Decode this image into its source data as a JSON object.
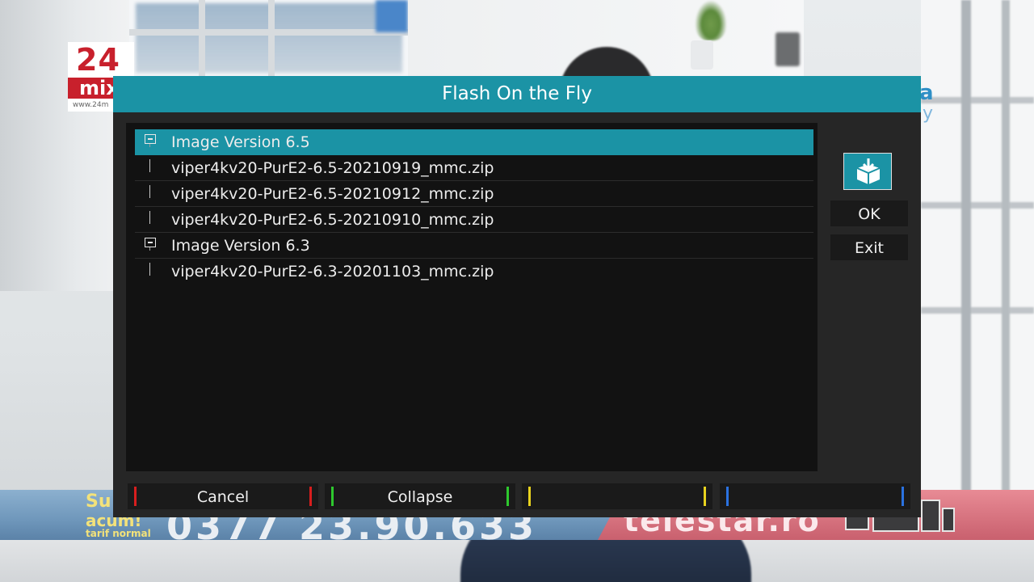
{
  "background": {
    "channel_logo": {
      "number": "24",
      "name": "mix",
      "url": "www.24m"
    },
    "right_logo": {
      "text": "a",
      "sub": "y"
    },
    "ticker": {
      "left_line1": "Su",
      "left_line2": "acum!",
      "left_line3": "tarif normal",
      "phone": "0377 23.90.633",
      "brand": "telestar.ro"
    }
  },
  "dialog": {
    "title": "Flash On the Fly",
    "accent_color": "#1b93a5",
    "list": {
      "rows": [
        {
          "type": "group",
          "label": "Image Version 6.5",
          "selected": true
        },
        {
          "type": "file",
          "label": "viper4kv20-PurE2-6.5-20210919_mmc.zip",
          "selected": false
        },
        {
          "type": "file",
          "label": "viper4kv20-PurE2-6.5-20210912_mmc.zip",
          "selected": false
        },
        {
          "type": "file",
          "label": "viper4kv20-PurE2-6.5-20210910_mmc.zip",
          "selected": false
        },
        {
          "type": "group",
          "label": "Image Version 6.3",
          "selected": false
        },
        {
          "type": "file",
          "label": "viper4kv20-PurE2-6.3-20201103_mmc.zip",
          "selected": false
        }
      ]
    },
    "side_buttons": {
      "icon": "download-box-icon",
      "ok_label": "OK",
      "exit_label": "Exit"
    },
    "color_buttons": [
      {
        "key": "red",
        "label": "Cancel",
        "color": "#d81e1e"
      },
      {
        "key": "green",
        "label": "Collapse",
        "color": "#2ec82e"
      },
      {
        "key": "yellow",
        "label": "",
        "color": "#e8d21e"
      },
      {
        "key": "blue",
        "label": "",
        "color": "#2a72e0"
      }
    ]
  }
}
